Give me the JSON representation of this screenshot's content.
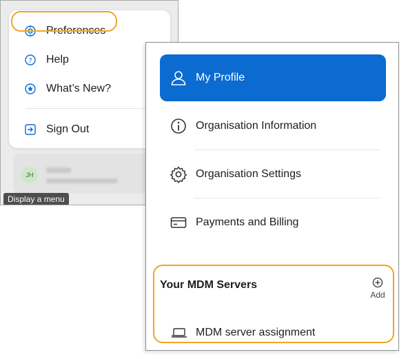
{
  "left_menu": {
    "items": [
      {
        "label": "Preferences",
        "icon": "gear-icon"
      },
      {
        "label": "Help",
        "icon": "question-icon"
      },
      {
        "label": "What’s New?",
        "icon": "star-icon"
      },
      {
        "label": "Sign Out",
        "icon": "sign-out-icon"
      }
    ],
    "account": {
      "initials": "JH"
    },
    "tooltip": "Display a menu"
  },
  "right_menu": {
    "items": [
      {
        "label": "My Profile",
        "icon": "person-icon",
        "active": true
      },
      {
        "label": "Organisation Information",
        "icon": "info-icon"
      },
      {
        "label": "Organisation Settings",
        "icon": "gear-icon"
      },
      {
        "label": "Payments and Billing",
        "icon": "card-icon"
      }
    ],
    "mdm_section": {
      "title": "Your MDM Servers",
      "add_label": "Add",
      "item_label": "MDM server assignment"
    }
  },
  "colors": {
    "highlight": "#f0a520",
    "active_bg": "#0b6bd1"
  }
}
